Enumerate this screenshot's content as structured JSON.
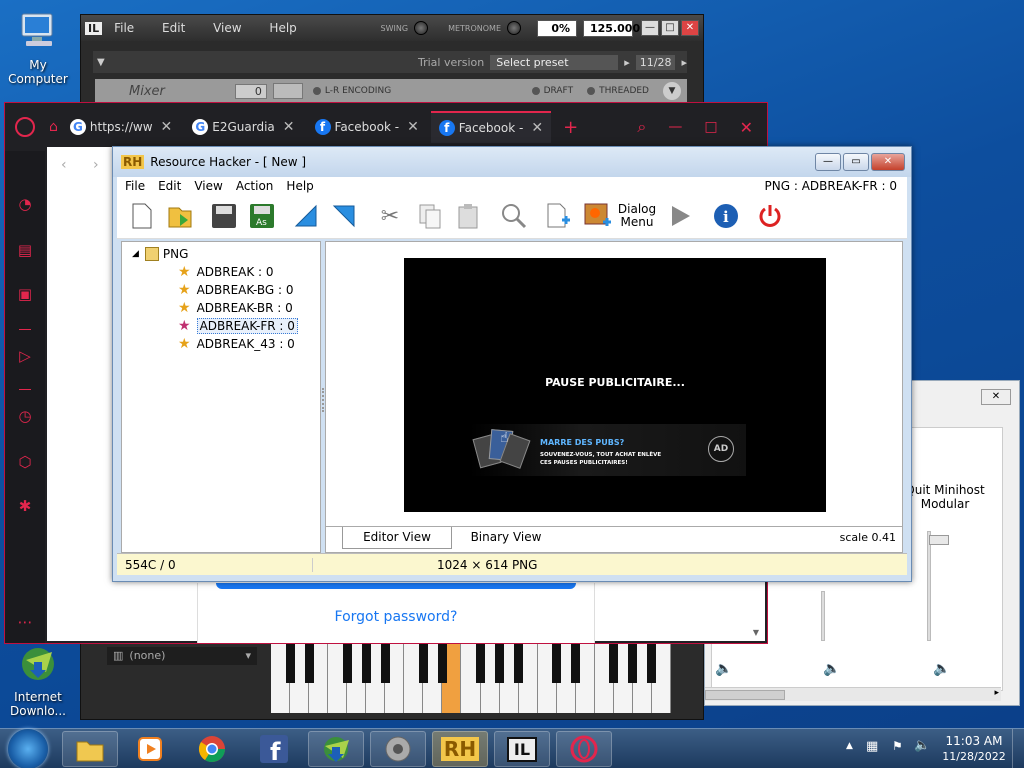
{
  "desktop": {
    "icons": [
      {
        "label": "My Computer"
      },
      {
        "label": "Internet Downlo..."
      }
    ]
  },
  "minihost": {
    "menu": [
      "File",
      "Edit",
      "View",
      "Help"
    ],
    "swing_label": "SWING",
    "metronome_label": "METRONOME",
    "percent": "0%",
    "tempo": "125.000",
    "trial_text": "Trial version",
    "preset_placeholder": "Select preset",
    "page": "11/28",
    "mixer_label": "Mixer",
    "mixer_value": "0",
    "lr_encoding": "L-R ENCODING",
    "draft": "DRAFT",
    "threaded": "THREADED",
    "bottom_select": "(none)"
  },
  "win3": {
    "label": "Quit Minihost Modular"
  },
  "browser": {
    "tabs": [
      {
        "label": "https://ww",
        "icon": "google-icon"
      },
      {
        "label": "E2Guardia",
        "icon": "google-icon"
      },
      {
        "label": "Facebook -",
        "icon": "facebook-icon"
      },
      {
        "label": "Facebook -",
        "icon": "facebook-icon",
        "active": true
      }
    ],
    "forgot_password": "Forgot password?",
    "accent": "#e2264d"
  },
  "resource_hacker": {
    "title": "Resource Hacker - [ New ]",
    "menu": [
      "File",
      "Edit",
      "View",
      "Action",
      "Help"
    ],
    "selection_info": "PNG : ADBREAK-FR : 0",
    "dialog_label_1": "Dialog",
    "dialog_label_2": "Menu",
    "tree": {
      "root": "PNG",
      "items": [
        {
          "label": "ADBREAK : 0"
        },
        {
          "label": "ADBREAK-BG : 0"
        },
        {
          "label": "ADBREAK-BR : 0"
        },
        {
          "label": "ADBREAK-FR : 0",
          "selected": true
        },
        {
          "label": "ADBREAK_43 : 0"
        }
      ]
    },
    "preview": {
      "headline": "PAUSE PUBLICITAIRE...",
      "promo_title": "MARRE DES PUBS?",
      "promo_body_1": "SOUVENEZ-VOUS, TOUT ACHAT ENLÈVE",
      "promo_body_2": "CES PAUSES PUBLICITAIRES!",
      "badge": "AD"
    },
    "tabs": {
      "editor": "Editor View",
      "binary": "Binary View"
    },
    "scale": "scale 0.41",
    "status": {
      "position": "554C / 0",
      "dimensions": "1024 × 614  PNG"
    }
  },
  "taskbar": {
    "time": "11:03 AM",
    "date": "11/28/2022"
  }
}
